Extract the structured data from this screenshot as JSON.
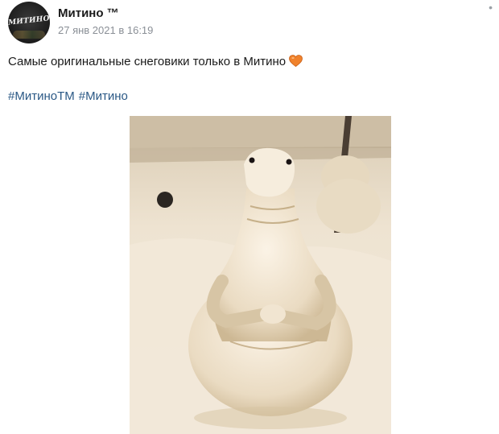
{
  "post": {
    "author": "Митино ™",
    "avatar_text": "МИТИНО",
    "date": "27 янв 2021 в 16:19",
    "text": "Самые оригинальные снеговики только в Митино",
    "emoji_icon": "orange-heart-icon",
    "hashtags": [
      "#МитиноТМ",
      "#Митино"
    ],
    "menu_icon": "more-dots-icon"
  },
  "colors": {
    "link": "#2a5885",
    "date": "#8a8f96",
    "heart": "#f0822c"
  }
}
